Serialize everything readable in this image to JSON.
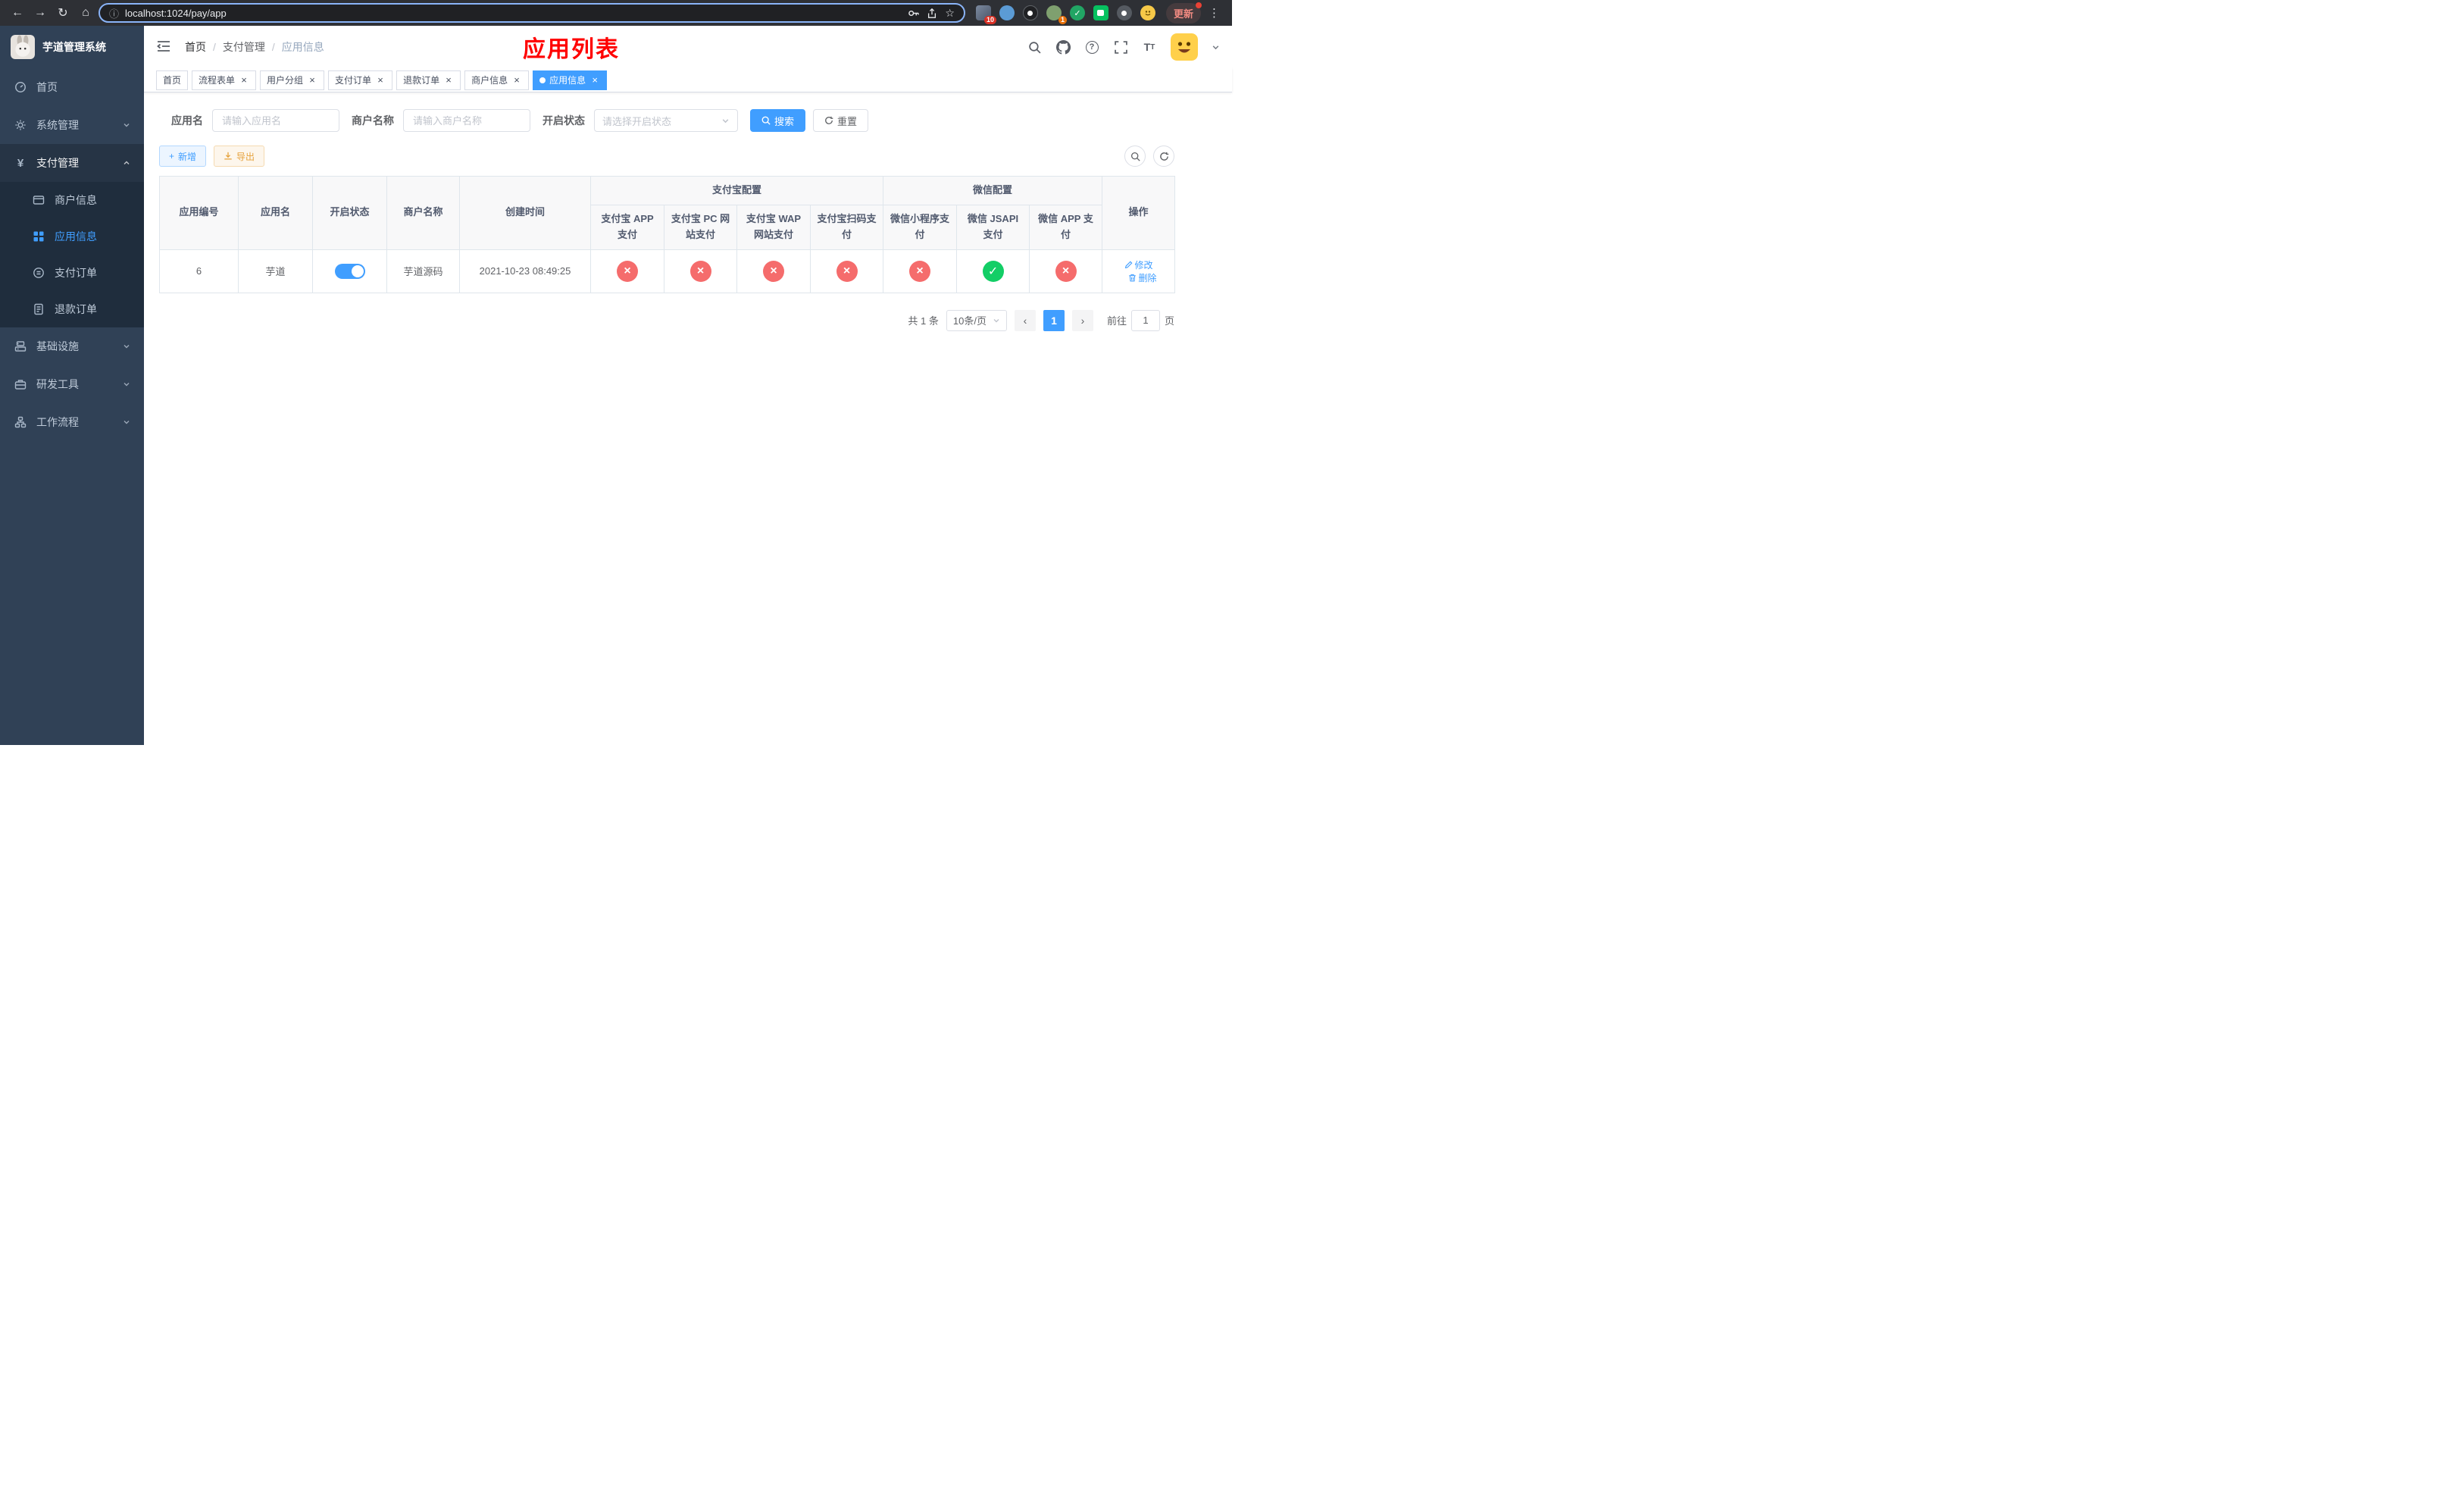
{
  "icons": {
    "back": "←",
    "forward": "→",
    "reload": "↻",
    "home": "⌂",
    "info": "ⓘ",
    "star": "☆",
    "menu_dots": "⋮",
    "check": "✓",
    "cross": "×",
    "plus": "+",
    "prev": "‹",
    "next": "›",
    "question": "?",
    "yen": "¥",
    "t_big": "T",
    "t_small": "T"
  },
  "browser": {
    "url": "localhost:1024/pay/app",
    "update_label": "更新",
    "extension_badge_1": "10",
    "extension_badge_2": "1"
  },
  "sidebar": {
    "logo_title": "芋道管理系统",
    "items": [
      {
        "label": "首页"
      },
      {
        "label": "系统管理"
      },
      {
        "label": "支付管理",
        "children": [
          {
            "label": "商户信息"
          },
          {
            "label": "应用信息"
          },
          {
            "label": "支付订单"
          },
          {
            "label": "退款订单"
          }
        ]
      },
      {
        "label": "基础设施"
      },
      {
        "label": "研发工具"
      },
      {
        "label": "工作流程"
      }
    ]
  },
  "header": {
    "breadcrumb": [
      "首页",
      "支付管理",
      "应用信息"
    ],
    "page_title": "应用列表"
  },
  "tabs": [
    {
      "label": "首页",
      "closable": false,
      "active": false
    },
    {
      "label": "流程表单",
      "closable": true,
      "active": false
    },
    {
      "label": "用户分组",
      "closable": true,
      "active": false
    },
    {
      "label": "支付订单",
      "closable": true,
      "active": false
    },
    {
      "label": "退款订单",
      "closable": true,
      "active": false
    },
    {
      "label": "商户信息",
      "closable": true,
      "active": false
    },
    {
      "label": "应用信息",
      "closable": true,
      "active": true
    }
  ],
  "filters": {
    "app_name_label": "应用名",
    "app_name_placeholder": "请输入应用名",
    "merchant_label": "商户名称",
    "merchant_placeholder": "请输入商户名称",
    "status_label": "开启状态",
    "status_placeholder": "请选择开启状态",
    "search_label": "搜索",
    "reset_label": "重置"
  },
  "toolbar": {
    "add_label": "新增",
    "export_label": "导出"
  },
  "table": {
    "columns": {
      "app_id": "应用编号",
      "app_name": "应用名",
      "status": "开启状态",
      "merchant": "商户名称",
      "created": "创建时间",
      "actions": "操作",
      "alipay_group": "支付宝配置",
      "alipay_sub": [
        "支付宝 APP 支付",
        "支付宝 PC 网站支付",
        "支付宝 WAP 网站支付",
        "支付宝扫码支付"
      ],
      "wechat_group": "微信配置",
      "wechat_sub": [
        "微信小程序支付",
        "微信 JSAPI 支付",
        "微信 APP 支付"
      ]
    },
    "rows": [
      {
        "app_id": "6",
        "app_name": "芋道",
        "enabled": true,
        "merchant": "芋道源码",
        "created": "2021-10-23 08:49:25",
        "configs": [
          false,
          false,
          false,
          false,
          false,
          true,
          false
        ],
        "edit_label": "修改",
        "delete_label": "删除"
      }
    ]
  },
  "pagination": {
    "total_text": "共 1 条",
    "page_size_text": "10条/页",
    "current_page": "1",
    "goto_label": "前往",
    "goto_value": "1",
    "page_unit_label": "页"
  }
}
